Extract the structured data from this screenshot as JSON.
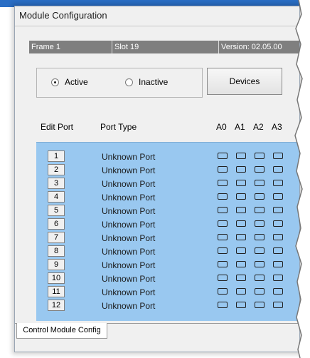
{
  "window": {
    "title": "Module Configuration"
  },
  "status": {
    "frame": "Frame 1",
    "slot": "Slot 19",
    "version": "Version: 02.05.00"
  },
  "mode": {
    "active_label": "Active",
    "inactive_label": "Inactive",
    "selected": "Active"
  },
  "devices_button": "Devices",
  "headers": {
    "edit_port": "Edit Port",
    "port_type": "Port Type",
    "a0": "A0",
    "a1": "A1",
    "a2": "A2",
    "a3": "A3"
  },
  "ports": [
    {
      "number": "1",
      "type": "Unknown Port"
    },
    {
      "number": "2",
      "type": "Unknown Port"
    },
    {
      "number": "3",
      "type": "Unknown Port"
    },
    {
      "number": "4",
      "type": "Unknown Port"
    },
    {
      "number": "5",
      "type": "Unknown Port"
    },
    {
      "number": "6",
      "type": "Unknown Port"
    },
    {
      "number": "7",
      "type": "Unknown Port"
    },
    {
      "number": "8",
      "type": "Unknown Port"
    },
    {
      "number": "9",
      "type": "Unknown Port"
    },
    {
      "number": "10",
      "type": "Unknown Port"
    },
    {
      "number": "11",
      "type": "Unknown Port"
    },
    {
      "number": "12",
      "type": "Unknown Port"
    }
  ],
  "tabs": [
    {
      "label": "Control Module Config"
    }
  ],
  "colors": {
    "panel_bg": "#99c8f0",
    "status_bg": "#7f7f7f",
    "caption_blue": "#2a6ec5"
  }
}
